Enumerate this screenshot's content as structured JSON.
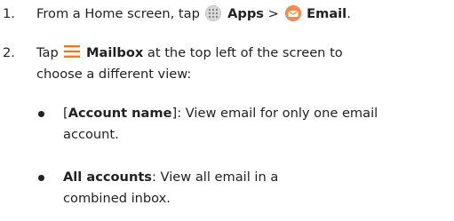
{
  "steps": [
    {
      "number": "1.",
      "prefix": "From a Home screen, tap",
      "apps_label": "Apps",
      "separator": ">",
      "email_label": "Email",
      "end": "."
    },
    {
      "number": "2.",
      "prefix": "Tap",
      "mailbox_label": "Mailbox",
      "line1_suffix": "at the top left of the screen to",
      "line2": "choose a different view:"
    }
  ],
  "bullets": [
    {
      "open_bracket": "[",
      "term": "Account name",
      "close_bracket": "]",
      "line1_desc": ": View email for only one email",
      "line2": "account."
    },
    {
      "term": "All accounts",
      "line1_desc": ": View all email in a",
      "line2": "combined inbox."
    }
  ],
  "icons": {
    "apps": "apps-grid-icon",
    "email": "email-app-icon",
    "mailbox": "hamburger-menu-icon"
  },
  "colors": {
    "text": "#222222",
    "accent_orange": "#f28b4b",
    "menu_icon_orange": "#f07a1a"
  }
}
